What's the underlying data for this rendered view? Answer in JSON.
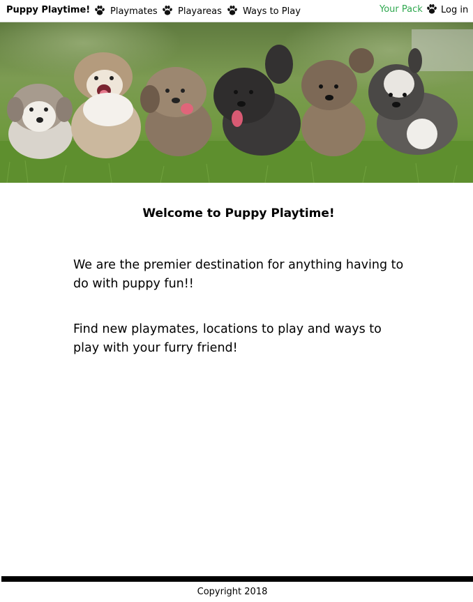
{
  "nav": {
    "brand": "Puppy Playtime!",
    "links": [
      {
        "label": "Playmates",
        "icon": "paw-icon"
      },
      {
        "label": "Playareas",
        "icon": "paw-icon"
      },
      {
        "label": "Ways to Play",
        "icon": "paw-icon"
      }
    ],
    "right": {
      "pack": "Your Pack",
      "login": "Log in",
      "icon": "paw-icon"
    }
  },
  "hero": {
    "image": "six fluffy puppies running on grass"
  },
  "main": {
    "title": "Welcome to Puppy Playtime!",
    "paragraphs": [
      "We are the premier destination for anything having to do with puppy fun!!",
      "Find new playmates, locations to play and ways to play with your furry friend!"
    ]
  },
  "footer": {
    "copyright": "Copyright 2018"
  },
  "colors": {
    "accent_green": "#2fa84f",
    "footer_bar": "#000000"
  }
}
